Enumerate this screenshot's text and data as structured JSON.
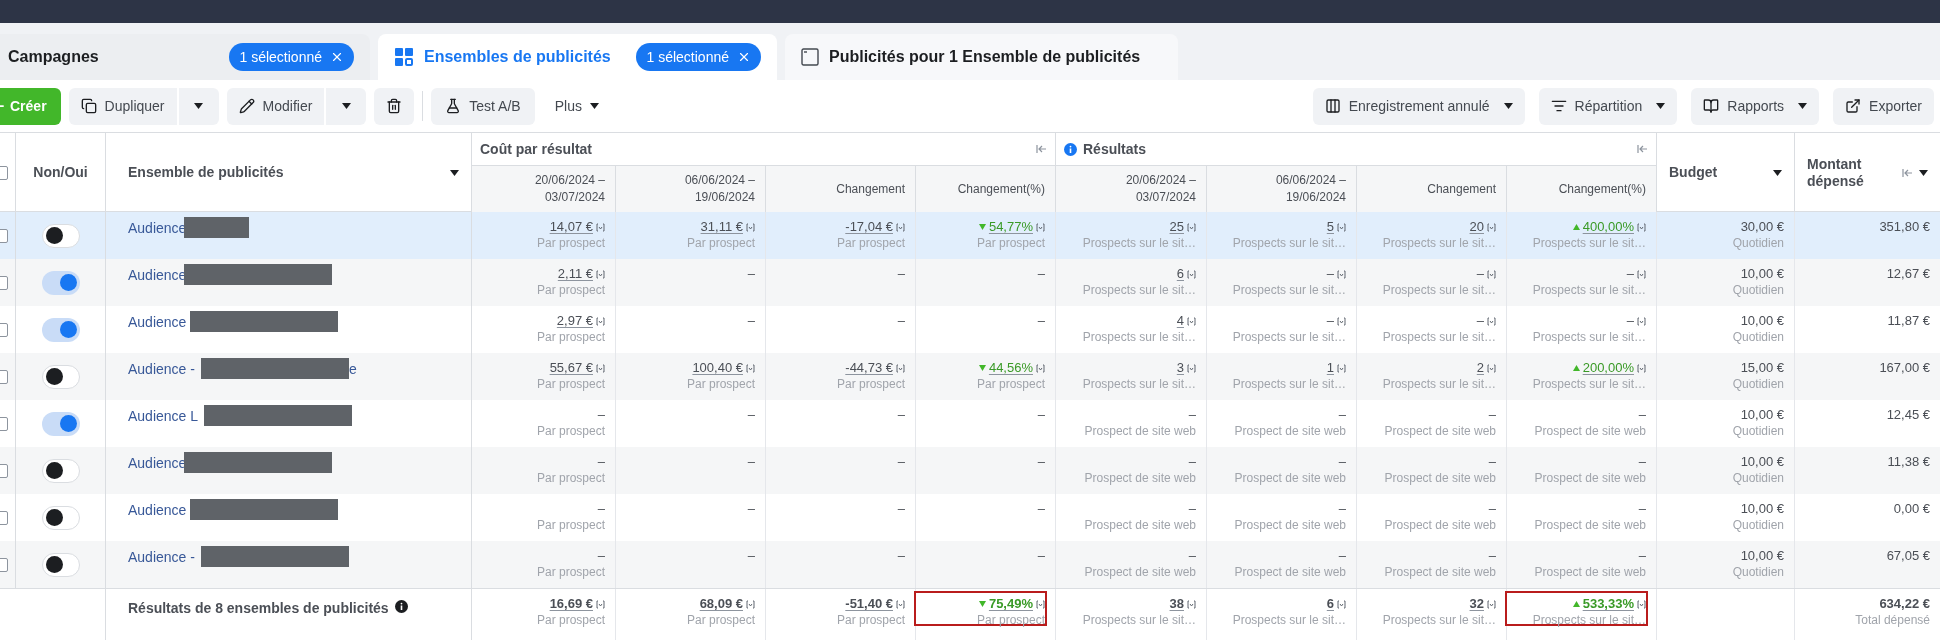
{
  "tabs": [
    {
      "kind": "campaigns",
      "label": "Campagnes",
      "badge": "1 sélectionné",
      "selected": false
    },
    {
      "kind": "adsets",
      "label": "Ensembles de publicités",
      "badge": "1 sélectionné",
      "selected": true
    },
    {
      "kind": "ads",
      "label": "Publicités pour 1 Ensemble de publicités",
      "selected": false
    }
  ],
  "toolbar": {
    "create": "Créer",
    "left": [
      {
        "kind": "duplicate",
        "label": "Dupliquer"
      },
      {
        "kind": "edit",
        "label": "Modifier"
      },
      {
        "kind": "delete"
      },
      {
        "kind": "divider"
      },
      {
        "kind": "abtest",
        "label": "Test A/B"
      },
      {
        "kind": "more",
        "label": "Plus"
      }
    ],
    "right": [
      {
        "label": "Enregistrement annulé",
        "menu": true
      },
      {
        "label": "Répartition",
        "menu": true
      },
      {
        "label": "Rapports",
        "menu": true
      },
      {
        "label": "Exporter",
        "menu": false
      }
    ]
  },
  "table": {
    "all_checked": false,
    "toggle_header": "Non/Oui",
    "name_header": "Ensemble de publicités",
    "groups": [
      {
        "label": "Coût par résultat",
        "info": false
      },
      {
        "label": "Résultats",
        "info": true
      }
    ],
    "columns": [
      "20/06/2024 – 03/07/2024",
      "06/06/2024 – 19/06/2024",
      "Changement",
      "Changement(%)",
      "20/06/2024 – 03/07/2024",
      "06/06/2024 – 19/06/2024",
      "Changement",
      "Changement(%)"
    ],
    "budget_header": "Budget",
    "spent_header": "Montant dépensé",
    "rows": [
      {
        "checked": false,
        "on": false,
        "selected": true,
        "name": "Audience",
        "redacted": true,
        "cells": [
          {
            "value": "14,07 €",
            "underlined": true,
            "info": true,
            "sub": "Par prospect"
          },
          {
            "value": "31,11 €",
            "underlined": true,
            "info": true,
            "sub": "Par prospect"
          },
          {
            "value": "-17,04 €",
            "underlined": true,
            "info": true,
            "sub": "Par prospect"
          },
          {
            "kind": "down",
            "value": "54,77%",
            "underlined": true,
            "info": true,
            "sub": "Par prospect"
          },
          {
            "value": "25",
            "underlined": true,
            "info": true,
            "sub": "Prospects sur le sit…"
          },
          {
            "value": "5",
            "underlined": true,
            "info": true,
            "sub": "Prospects sur le sit…"
          },
          {
            "value": "20",
            "underlined": true,
            "info": true,
            "sub": "Prospects sur le sit…"
          },
          {
            "kind": "up",
            "value": "400,00%",
            "underlined": true,
            "info": true,
            "sub": "Prospects sur le sit…"
          }
        ],
        "budget": "30,00 €",
        "budget_sub": "Quotidien",
        "spent": "351,80 €"
      },
      {
        "checked": false,
        "on": true,
        "selected": false,
        "name": "Audience",
        "redacted": true,
        "cells": [
          {
            "value": "2,11 €",
            "underlined": true,
            "info": true,
            "sub": "Par prospect"
          },
          {
            "value": "–"
          },
          {
            "value": "–"
          },
          {
            "value": "–"
          },
          {
            "value": "6",
            "underlined": true,
            "info": true,
            "sub": "Prospects sur le sit…"
          },
          {
            "value": "–",
            "info": true,
            "sub": "Prospects sur le sit…"
          },
          {
            "value": "–",
            "info": true,
            "sub": "Prospects sur le sit…"
          },
          {
            "value": "–",
            "info": true,
            "sub": "Prospects sur le sit…"
          }
        ],
        "budget": "10,00 €",
        "budget_sub": "Quotidien",
        "spent": "12,67 €"
      },
      {
        "checked": false,
        "on": true,
        "selected": false,
        "name": "Audience",
        "redacted": true,
        "cells": [
          {
            "value": "2,97 €",
            "underlined": true,
            "info": true,
            "sub": "Par prospect"
          },
          {
            "value": "–"
          },
          {
            "value": "–"
          },
          {
            "value": "–"
          },
          {
            "value": "4",
            "underlined": true,
            "info": true,
            "sub": "Prospects sur le sit…"
          },
          {
            "value": "–",
            "info": true,
            "sub": "Prospects sur le sit…"
          },
          {
            "value": "–",
            "info": true,
            "sub": "Prospects sur le sit…"
          },
          {
            "value": "–",
            "info": true,
            "sub": "Prospects sur le sit…"
          }
        ],
        "budget": "10,00 €",
        "budget_sub": "Quotidien",
        "spent": "11,87 €"
      },
      {
        "checked": false,
        "on": false,
        "selected": false,
        "name": "Audience -",
        "name_tail": "e",
        "redacted": true,
        "cells": [
          {
            "value": "55,67 €",
            "underlined": true,
            "info": true,
            "sub": "Par prospect"
          },
          {
            "value": "100,40 €",
            "underlined": true,
            "info": true,
            "sub": "Par prospect"
          },
          {
            "value": "-44,73 €",
            "underlined": true,
            "info": true,
            "sub": "Par prospect"
          },
          {
            "kind": "down",
            "value": "44,56%",
            "underlined": true,
            "info": true,
            "sub": "Par prospect"
          },
          {
            "value": "3",
            "underlined": true,
            "info": true,
            "sub": "Prospects sur le sit…"
          },
          {
            "value": "1",
            "underlined": true,
            "info": true,
            "sub": "Prospects sur le sit…"
          },
          {
            "value": "2",
            "underlined": true,
            "info": true,
            "sub": "Prospects sur le sit…"
          },
          {
            "kind": "up",
            "value": "200,00%",
            "underlined": true,
            "info": true,
            "sub": "Prospects sur le sit…"
          }
        ],
        "budget": "15,00 €",
        "budget_sub": "Quotidien",
        "spent": "167,00 €"
      },
      {
        "checked": false,
        "on": true,
        "selected": false,
        "name": "Audience L",
        "redacted": true,
        "cells": [
          {
            "value": "–",
            "sub": "Par prospect"
          },
          {
            "value": "–"
          },
          {
            "value": "–"
          },
          {
            "value": "–"
          },
          {
            "value": "–",
            "sub": "Prospect de site web"
          },
          {
            "value": "–",
            "sub": "Prospect de site web"
          },
          {
            "value": "–",
            "sub": "Prospect de site web"
          },
          {
            "value": "–",
            "sub": "Prospect de site web"
          }
        ],
        "budget": "10,00 €",
        "budget_sub": "Quotidien",
        "spent": "12,45 €"
      },
      {
        "checked": false,
        "on": false,
        "selected": false,
        "name": "Audience",
        "redacted": true,
        "cells": [
          {
            "value": "–",
            "sub": "Par prospect"
          },
          {
            "value": "–"
          },
          {
            "value": "–"
          },
          {
            "value": "–"
          },
          {
            "value": "–",
            "sub": "Prospect de site web"
          },
          {
            "value": "–",
            "sub": "Prospect de site web"
          },
          {
            "value": "–",
            "sub": "Prospect de site web"
          },
          {
            "value": "–",
            "sub": "Prospect de site web"
          }
        ],
        "budget": "10,00 €",
        "budget_sub": "Quotidien",
        "spent": "11,38 €"
      },
      {
        "checked": false,
        "on": false,
        "selected": false,
        "name": "Audience",
        "redacted": true,
        "cells": [
          {
            "value": "–",
            "sub": "Par prospect"
          },
          {
            "value": "–"
          },
          {
            "value": "–"
          },
          {
            "value": "–"
          },
          {
            "value": "–",
            "sub": "Prospect de site web"
          },
          {
            "value": "–",
            "sub": "Prospect de site web"
          },
          {
            "value": "–",
            "sub": "Prospect de site web"
          },
          {
            "value": "–",
            "sub": "Prospect de site web"
          }
        ],
        "budget": "10,00 €",
        "budget_sub": "Quotidien",
        "spent": "0,00 €"
      },
      {
        "checked": false,
        "on": false,
        "selected": false,
        "name": "Audience -",
        "redacted": true,
        "cells": [
          {
            "value": "–",
            "sub": "Par prospect"
          },
          {
            "value": "–"
          },
          {
            "value": "–"
          },
          {
            "value": "–"
          },
          {
            "value": "–",
            "sub": "Prospect de site web"
          },
          {
            "value": "–",
            "sub": "Prospect de site web"
          },
          {
            "value": "–",
            "sub": "Prospect de site web"
          },
          {
            "value": "–",
            "sub": "Prospect de site web"
          }
        ],
        "budget": "10,00 €",
        "budget_sub": "Quotidien",
        "spent": "67,05 €"
      }
    ],
    "totals": {
      "label": "Résultats de 8 ensembles de publicités",
      "cells": [
        {
          "value": "16,69 €",
          "underlined": true,
          "info": true,
          "sub": "Par prospect"
        },
        {
          "value": "68,09 €",
          "underlined": true,
          "info": true,
          "sub": "Par prospect"
        },
        {
          "value": "-51,40 €",
          "underlined": true,
          "info": true,
          "sub": "Par prospect"
        },
        {
          "kind": "down",
          "value": "75,49%",
          "underlined": true,
          "info": true,
          "sub": "Par prospect",
          "annotated": true
        },
        {
          "value": "38",
          "underlined": true,
          "info": true,
          "sub": "Prospects sur le sit…"
        },
        {
          "value": "6",
          "underlined": true,
          "info": true,
          "sub": "Prospects sur le sit…"
        },
        {
          "value": "32",
          "underlined": true,
          "info": true,
          "sub": "Prospects sur le sit…"
        },
        {
          "kind": "up",
          "value": "533,33%",
          "underlined": true,
          "info": true,
          "sub": "Prospects sur le sit…",
          "annotated": true
        }
      ],
      "spent": "634,22 €",
      "spent_sub": "Total dépensé"
    }
  }
}
